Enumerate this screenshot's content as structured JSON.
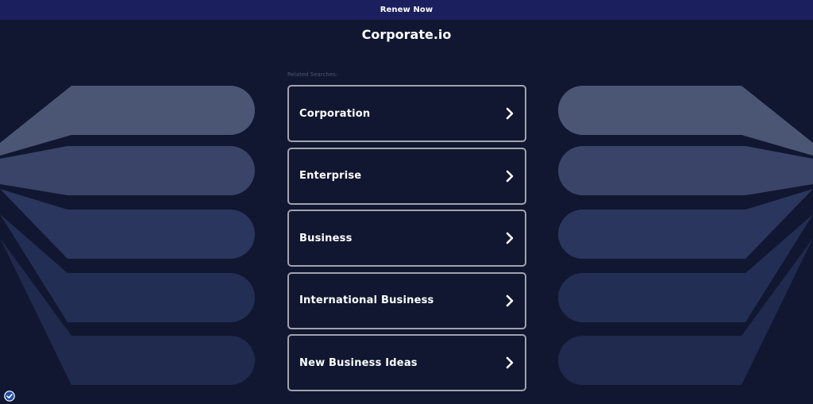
{
  "topbar": {
    "renew_label": "Renew Now"
  },
  "site": {
    "domain": "Corporate.io"
  },
  "related": {
    "label": "Related Searches:",
    "items": [
      {
        "label": "Corporation"
      },
      {
        "label": "Enterprise"
      },
      {
        "label": "Business"
      },
      {
        "label": "International Business"
      },
      {
        "label": "New Business Ideas"
      }
    ]
  },
  "icons": {
    "chevron": "chevron-right-icon",
    "badge": "privacy-badge-icon"
  },
  "colors": {
    "background": "#111730",
    "topbar": "#1b1f5e",
    "card_border": "#a0a3ad",
    "text": "#ffffff"
  }
}
